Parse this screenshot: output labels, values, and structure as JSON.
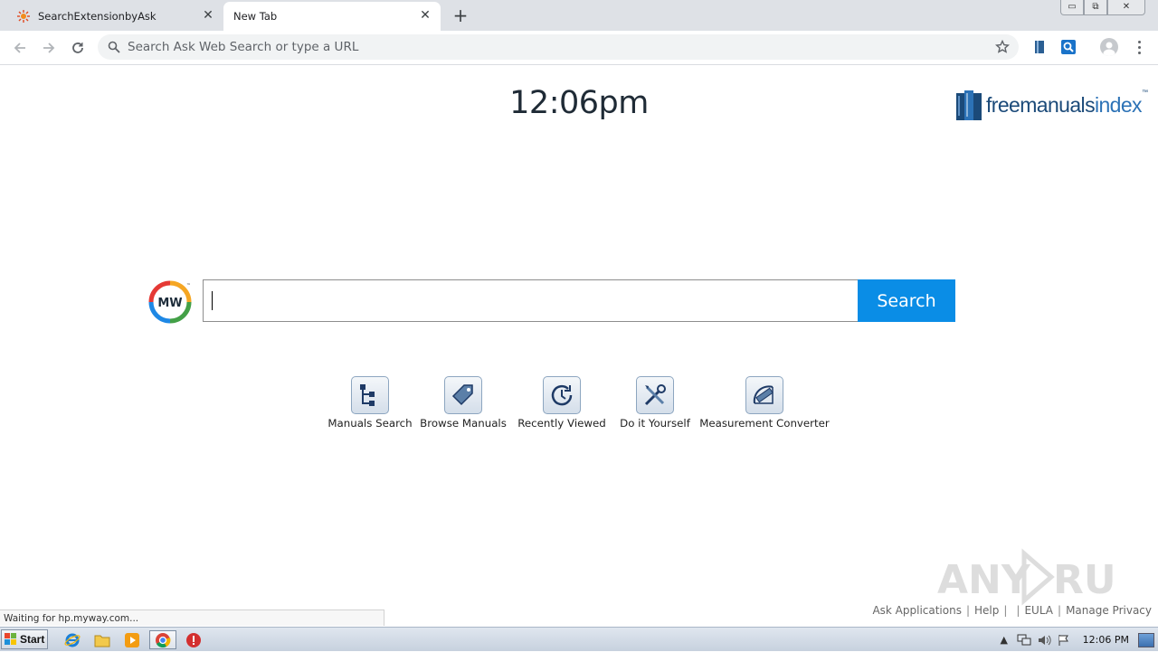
{
  "browser": {
    "tabs": [
      {
        "label": "SearchExtensionbyAsk",
        "active": false
      },
      {
        "label": "New Tab",
        "active": true
      }
    ],
    "new_tab_symbol": "+",
    "close_symbol": "✕",
    "omnibox_placeholder": "Search Ask Web Search or type a URL",
    "window_controls": {
      "minimize": "▭",
      "restore": "⧉",
      "close": "✕"
    }
  },
  "page": {
    "clock": "12:06pm",
    "brand": {
      "bold": "freemanuals",
      "light": "index",
      "tm": "™"
    },
    "search_logo_text": "MW",
    "search_logo_tm": "™",
    "search_button": "Search",
    "shortcuts": [
      {
        "label": "Manuals Search",
        "icon": "sitemap-icon"
      },
      {
        "label": "Browse Manuals",
        "icon": "tag-icon"
      },
      {
        "label": "Recently Viewed",
        "icon": "clock-history-icon"
      },
      {
        "label": "Do it Yourself",
        "icon": "tools-icon"
      },
      {
        "label": "Measurement Converter",
        "icon": "ruler-protractor-icon"
      }
    ],
    "footer": {
      "ask_applications": "Ask Applications",
      "help": "Help",
      "eula": "EULA",
      "manage_privacy": "Manage Privacy",
      "separator": "|"
    },
    "status": "Waiting for hp.myway.com..."
  },
  "taskbar": {
    "start": "Start",
    "time": "12:06 PM"
  },
  "colors": {
    "search_button": "#0a8de6",
    "brand_dark": "#1b4a79",
    "brand_light": "#2c72b6",
    "tab_strip": "#dee1e6"
  }
}
